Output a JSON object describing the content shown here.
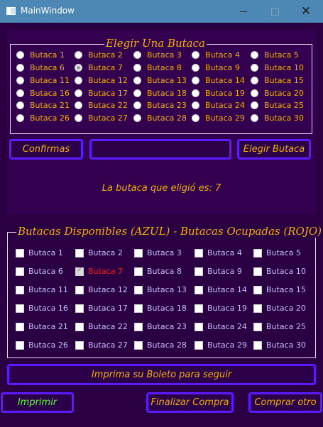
{
  "window": {
    "title": "MainWindow",
    "min_icon": "minimize-icon",
    "max_icon": "maximize-icon",
    "close_icon": "close-icon"
  },
  "select_group": {
    "title": "Elegir Una Butaca",
    "selected": 7
  },
  "seats": [
    "Butaca 1",
    "Butaca 2",
    "Butaca 3",
    "Butaca 4",
    "Butaca 5",
    "Butaca 6",
    "Butaca 7",
    "Butaca 8",
    "Butaca 9",
    "Butaca 10",
    "Butaca 11",
    "Butaca 12",
    "Butaca 13",
    "Butaca 14",
    "Butaca 15",
    "Butaca 16",
    "Butaca 17",
    "Butaca 18",
    "Butaca 19",
    "Butaca 20",
    "Butaca 21",
    "Butaca 22",
    "Butaca 23",
    "Butaca 24",
    "Butaca 25",
    "Butaca 26",
    "Butaca 27",
    "Butaca 28",
    "Butaca 29",
    "Butaca 30"
  ],
  "actions": {
    "confirm": "Confirmas",
    "input_value": "",
    "choose": "Elegir Butaca"
  },
  "result_text": "La butaca que eligió es: 7",
  "availability_group": {
    "title": "Butacas Disponibles (AZUL) - Butacas Ocupadas (ROJO)",
    "occupied": [
      7
    ]
  },
  "print_prompt": "Imprima su Boleto para seguir",
  "bottom": {
    "print": "Imprimir",
    "finish": "Finalizar Compra",
    "again": "Comprar otro"
  },
  "colors": {
    "accent": "#f0b200",
    "button_border": "#5c1bff",
    "available": "#c8c0ff",
    "occupied": "#ff1a1a",
    "print_label": "#5cff3a"
  }
}
